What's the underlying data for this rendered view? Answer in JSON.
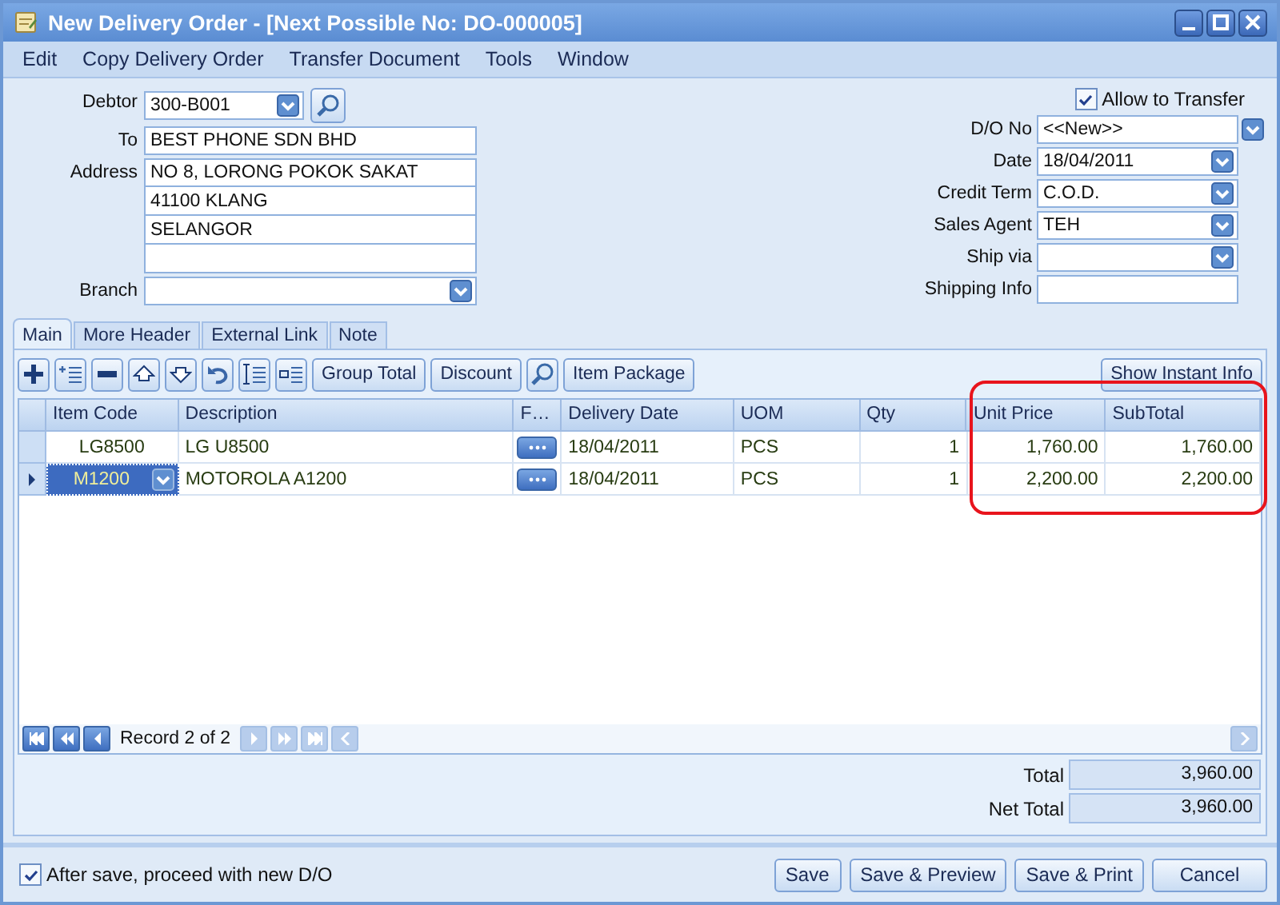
{
  "window": {
    "title": "New Delivery Order - [Next Possible No: DO-000005]"
  },
  "menu": [
    "Edit",
    "Copy Delivery Order",
    "Transfer Document",
    "Tools",
    "Window"
  ],
  "header": {
    "debtor": {
      "label": "Debtor",
      "value": "300-B001"
    },
    "to": {
      "label": "To",
      "value": "BEST PHONE SDN BHD"
    },
    "address": {
      "label": "Address",
      "lines": [
        "NO 8, LORONG POKOK SAKAT",
        "41100 KLANG",
        "SELANGOR"
      ]
    },
    "branch": {
      "label": "Branch"
    },
    "allow_transfer": {
      "label": "Allow to Transfer",
      "checked": true
    },
    "fields": [
      {
        "label": "D/O No",
        "value": "<<New>>",
        "kind": "combo-outside"
      },
      {
        "label": "Date",
        "value": "18/04/2011",
        "kind": "dropdown"
      },
      {
        "label": "Credit Term",
        "value": "C.O.D.",
        "kind": "dropdown"
      },
      {
        "label": "Sales Agent",
        "value": "TEH",
        "kind": "dropdown"
      },
      {
        "label": "Ship via",
        "kind": "dropdown"
      },
      {
        "label": "Shipping Info",
        "kind": "text"
      }
    ]
  },
  "tabs": [
    {
      "label": "Main",
      "selected": true
    },
    {
      "label": "More Header",
      "selected": false
    },
    {
      "label": "External Link",
      "selected": false
    },
    {
      "label": "Note",
      "selected": false
    }
  ],
  "toolbar": {
    "buttons": [
      "Group Total",
      "Discount"
    ],
    "package_button": "Item Package",
    "right_button": "Show Instant Info"
  },
  "table": {
    "columns": [
      "Item Code",
      "Description",
      "F…",
      "Delivery Date",
      "UOM",
      "Qty",
      "Unit Price",
      "SubTotal"
    ],
    "rows": [
      {
        "item_code": "LG8500",
        "description": "LG U8500",
        "delivery_date": "18/04/2011",
        "uom": "PCS",
        "qty": "1",
        "unit_price": "1,760.00",
        "subtotal": "1,760.00",
        "selected": false
      },
      {
        "item_code": "M1200",
        "description": "MOTOROLA A1200",
        "delivery_date": "18/04/2011",
        "uom": "PCS",
        "qty": "1",
        "unit_price": "2,200.00",
        "subtotal": "2,200.00",
        "selected": true
      }
    ]
  },
  "navigator": {
    "record": "Record 2 of 2"
  },
  "totals": [
    {
      "label": "Total",
      "value": "3,960.00"
    },
    {
      "label": "Net Total",
      "value": "3,960.00"
    }
  ],
  "footer": {
    "proceed": {
      "label": "After save, proceed with new D/O",
      "checked": true
    },
    "buttons": [
      "Save",
      "Save & Preview",
      "Save & Print",
      "Cancel"
    ]
  }
}
